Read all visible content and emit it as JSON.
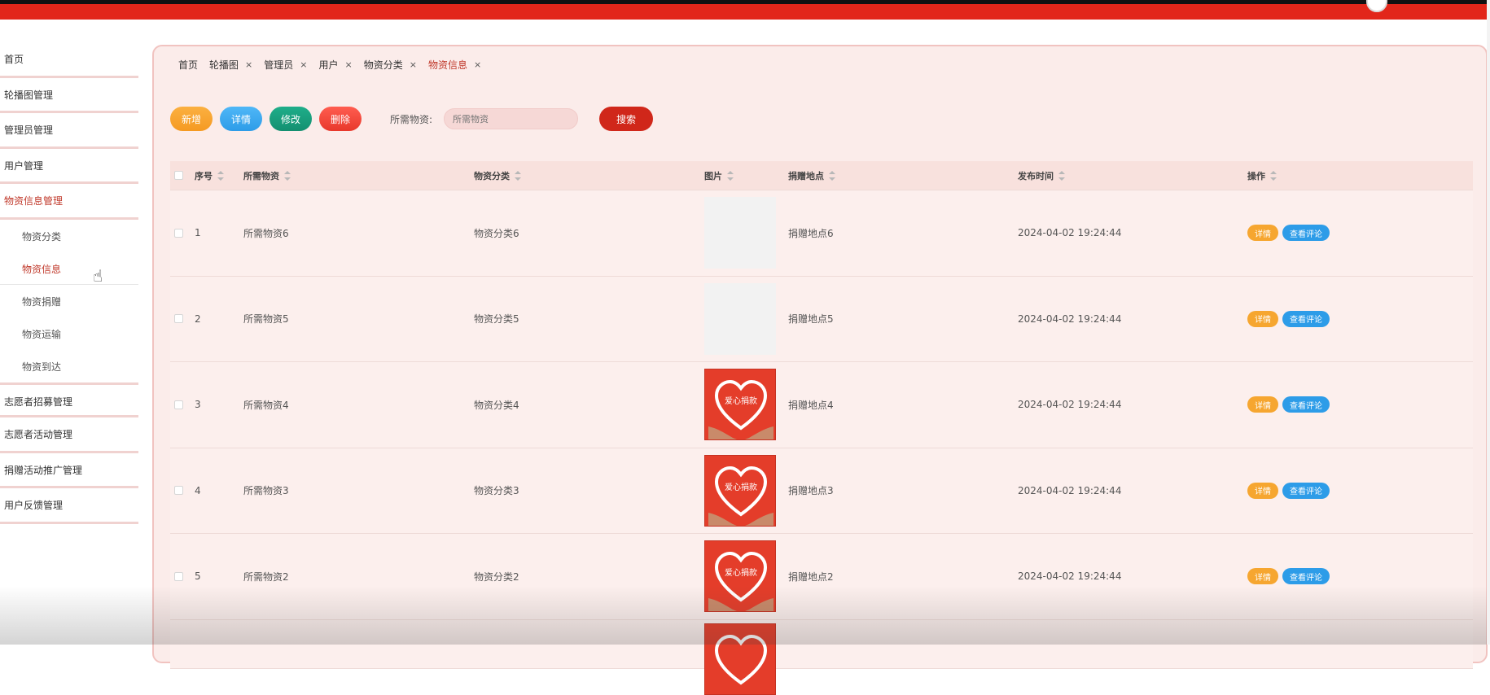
{
  "sidebar": {
    "items": [
      {
        "label": "首页"
      },
      {
        "label": "轮播图管理"
      },
      {
        "label": "管理员管理"
      },
      {
        "label": "用户管理"
      },
      {
        "label": "物资信息管理"
      },
      {
        "label": "志愿者招募管理"
      },
      {
        "label": "志愿者活动管理"
      },
      {
        "label": "捐赠活动推广管理"
      },
      {
        "label": "用户反馈管理"
      }
    ],
    "subitems": [
      {
        "label": "物资分类"
      },
      {
        "label": "物资信息"
      },
      {
        "label": "物资捐赠"
      },
      {
        "label": "物资运输"
      },
      {
        "label": "物资到达"
      }
    ]
  },
  "tabs": [
    {
      "label": "首页"
    },
    {
      "label": "轮播图",
      "close": "×"
    },
    {
      "label": "管理员",
      "close": "×"
    },
    {
      "label": "用户",
      "close": "×"
    },
    {
      "label": "物资分类",
      "close": "×"
    },
    {
      "label": "物资信息",
      "close": "×"
    }
  ],
  "toolbar": {
    "add_label": "新增",
    "detail_label": "详情",
    "edit_label": "修改",
    "delete_label": "删除",
    "search_label": "所需物资:",
    "search_placeholder": "所需物资",
    "search_button": "搜索"
  },
  "table": {
    "headers": {
      "no": "序号",
      "name": "所需物资",
      "category": "物资分类",
      "image": "图片",
      "address": "捐赠地点",
      "time": "发布时间",
      "ops": "操作"
    },
    "image_caption": "爱心捐款",
    "op_detail": "详情",
    "op_comment": "查看评论",
    "rows": [
      {
        "no": "1",
        "name": "所需物资6",
        "category": "物资分类6",
        "address": "捐赠地点6",
        "time": "2024-04-02 19:24:44"
      },
      {
        "no": "2",
        "name": "所需物资5",
        "category": "物资分类5",
        "address": "捐赠地点5",
        "time": "2024-04-02 19:24:44"
      },
      {
        "no": "3",
        "name": "所需物资4",
        "category": "物资分类4",
        "address": "捐赠地点4",
        "time": "2024-04-02 19:24:44"
      },
      {
        "no": "4",
        "name": "所需物资3",
        "category": "物资分类3",
        "address": "捐赠地点3",
        "time": "2024-04-02 19:24:44"
      },
      {
        "no": "5",
        "name": "所需物资2",
        "category": "物资分类2",
        "address": "捐赠地点2",
        "time": "2024-04-02 19:24:44"
      }
    ]
  },
  "colors": {
    "brand": "#e2261a",
    "active_text": "#c0392b",
    "panel_bg": "#fbecea"
  }
}
